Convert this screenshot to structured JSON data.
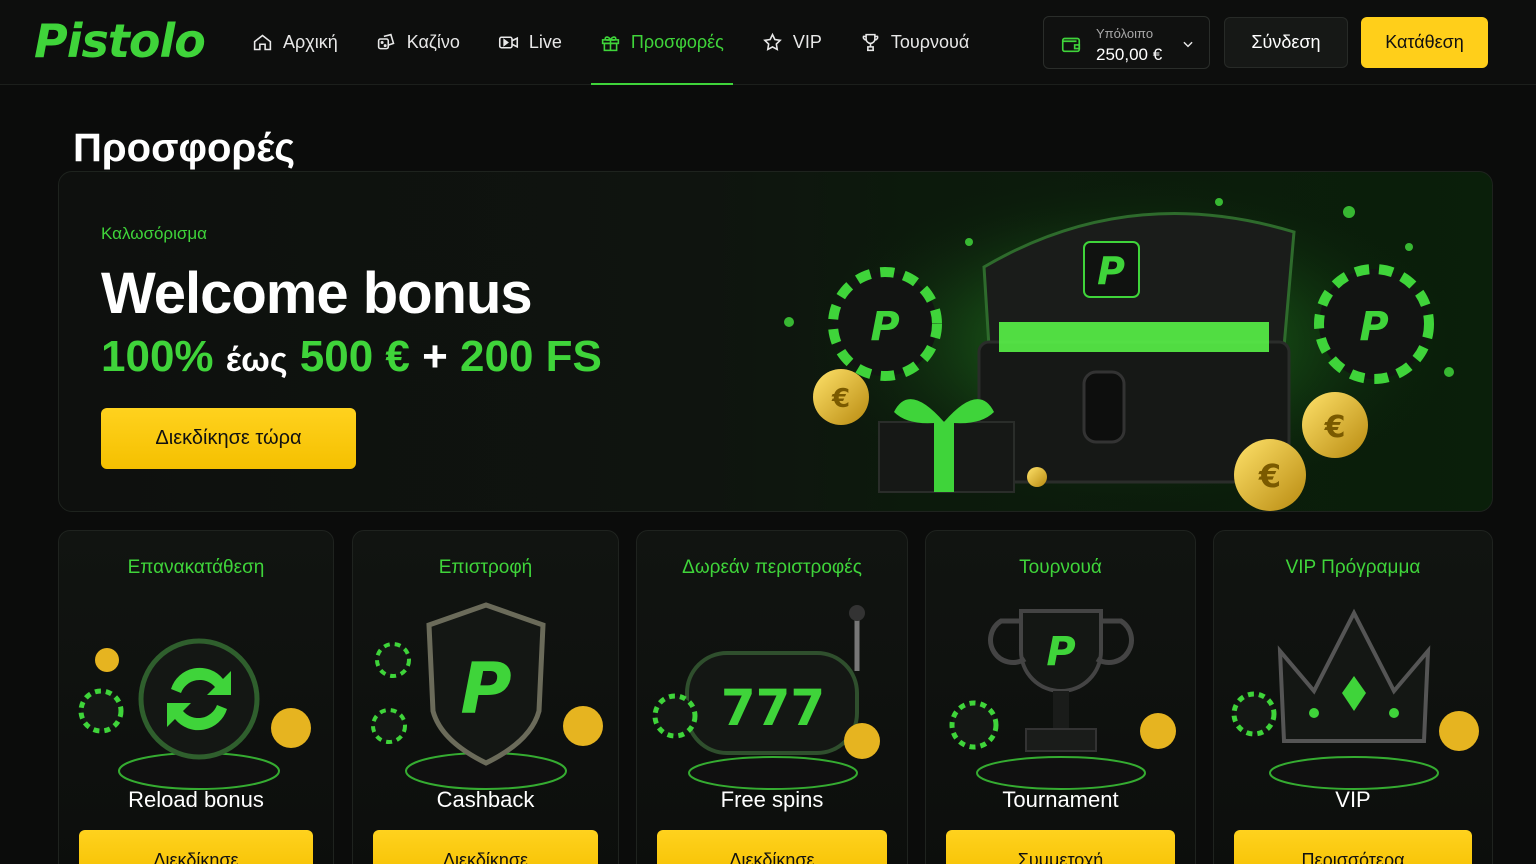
{
  "brand": {
    "logo": "Pistolo",
    "accent": "#3fd43a",
    "cta_color": "#ffcf1a"
  },
  "nav": {
    "items": [
      {
        "label": "Αρχική",
        "icon": "home-icon"
      },
      {
        "label": "Καζίνο",
        "icon": "dice-icon"
      },
      {
        "label": "Live",
        "icon": "live-camera-icon"
      },
      {
        "label": "Προσφορές",
        "icon": "gift-icon",
        "active": true
      },
      {
        "label": "VIP",
        "icon": "star-icon"
      },
      {
        "label": "Τουρνουά",
        "icon": "trophy-icon"
      }
    ],
    "balance_label": "Υπόλοιπο",
    "balance_amount": "250,00 €",
    "login": "Σύνδεση",
    "deposit": "Κατάθεση"
  },
  "page_title": "Προσφορές",
  "hero": {
    "kicker": "Καλωσόρισμα",
    "title": "Welcome bonus",
    "offer_pct": "100%",
    "offer_word": "έως",
    "offer_amount": "500 €",
    "offer_plus": "+",
    "offer_fs": "200 FS",
    "cta": "Διεκδίκησε τώρα"
  },
  "cards": [
    {
      "category": "Επανακατάθεση",
      "name": "Reload bonus",
      "button": "Διεκδίκησε",
      "icon": "reload-icon"
    },
    {
      "category": "Επιστροφή",
      "name": "Cashback",
      "button": "Διεκδίκησε",
      "icon": "shield-icon"
    },
    {
      "category": "Δωρεάν περιστροφές",
      "name": "Free spins",
      "button": "Διεκδίκησε",
      "icon": "slot-machine-icon"
    },
    {
      "category": "Τουρνουά",
      "name": "Tournament",
      "button": "Συμμετοχή",
      "icon": "trophy-icon"
    },
    {
      "category": "VIP Πρόγραμμα",
      "name": "VIP",
      "button": "Περισσότερα",
      "icon": "crown-icon"
    }
  ]
}
